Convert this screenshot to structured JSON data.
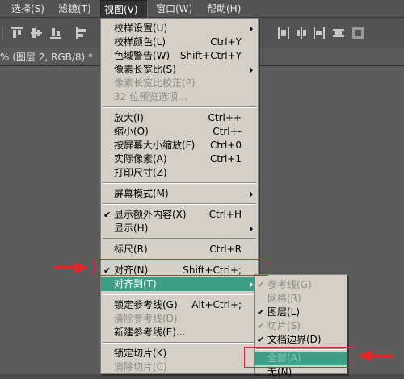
{
  "menubar": {
    "items": [
      {
        "label": "选择(S)"
      },
      {
        "label": "滤镜(T)"
      },
      {
        "label": "视图(V)"
      },
      {
        "label": "窗口(W)"
      },
      {
        "label": "帮助(H)"
      }
    ]
  },
  "document_tab": {
    "title": "% (图层 2, RGB/8) *"
  },
  "view_menu": {
    "items": [
      {
        "label": "校样设置(U)",
        "shortcut": "",
        "submenu": true
      },
      {
        "label": "校样颜色(L)",
        "shortcut": "Ctrl+Y"
      },
      {
        "label": "色域警告(W)",
        "shortcut": "Shift+Ctrl+Y"
      },
      {
        "label": "像素长宽比(S)",
        "shortcut": "",
        "submenu": true
      },
      {
        "label": "像素长宽比校正(P)",
        "shortcut": "",
        "disabled": true
      },
      {
        "label": "32 位预览选项...",
        "shortcut": "",
        "disabled": true
      },
      {
        "label": "放大(I)",
        "shortcut": "Ctrl++"
      },
      {
        "label": "缩小(O)",
        "shortcut": "Ctrl+-"
      },
      {
        "label": "按屏幕大小缩放(F)",
        "shortcut": "Ctrl+0"
      },
      {
        "label": "实际像素(A)",
        "shortcut": "Ctrl+1"
      },
      {
        "label": "打印尺寸(Z)",
        "shortcut": ""
      },
      {
        "label": "屏幕模式(M)",
        "shortcut": "",
        "submenu": true
      },
      {
        "label": "显示额外内容(X)",
        "shortcut": "Ctrl+H",
        "checked": true
      },
      {
        "label": "显示(H)",
        "shortcut": "",
        "submenu": true
      },
      {
        "label": "标尺(R)",
        "shortcut": "Ctrl+R"
      },
      {
        "label": "对齐(N)",
        "shortcut": "Shift+Ctrl+;",
        "checked": true
      },
      {
        "label": "对齐到(T)",
        "shortcut": "",
        "submenu": true,
        "highlighted": true
      },
      {
        "label": "锁定参考线(G)",
        "shortcut": "Alt+Ctrl+;"
      },
      {
        "label": "清除参考线(D)",
        "shortcut": "",
        "disabled": true
      },
      {
        "label": "新建参考线(E)...",
        "shortcut": ""
      },
      {
        "label": "锁定切片(K)",
        "shortcut": ""
      },
      {
        "label": "清除切片(C)",
        "shortcut": "",
        "disabled": true
      }
    ]
  },
  "snap_to_submenu": {
    "items": [
      {
        "label": "参考线(G)",
        "checked": true,
        "disabled": true
      },
      {
        "label": "网格(R)",
        "checked": false,
        "disabled": true
      },
      {
        "label": "图层(L)",
        "checked": true,
        "disabled": false
      },
      {
        "label": "切片(S)",
        "checked": true,
        "disabled": true
      },
      {
        "label": "文档边界(D)",
        "checked": true,
        "disabled": false
      },
      {
        "label": "全部(A)",
        "checked": false,
        "disabled": false,
        "highlighted": true
      },
      {
        "label": "无(N)",
        "checked": false,
        "disabled": false
      }
    ]
  },
  "check_glyph": "✔",
  "colors": {
    "highlight": "#3f9e86",
    "annotation": "#e0272a"
  }
}
